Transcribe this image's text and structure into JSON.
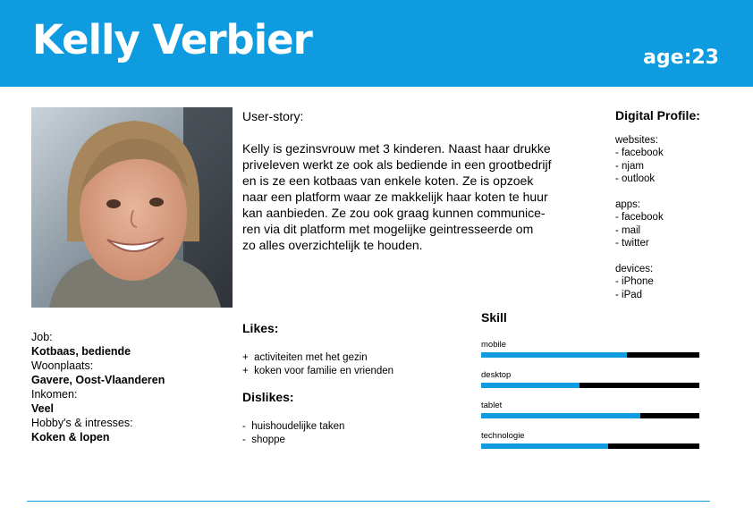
{
  "header": {
    "name": "Kelly Verbier",
    "age": "age:23"
  },
  "story": {
    "title": "User-story:",
    "lines": [
      "Kelly is gezinsvrouw met 3 kinderen. Naast haar drukke",
      "priveleven werkt ze ook als bediende in een grootbedrijf",
      "en is ze een kotbaas van enkele koten. Ze is opzoek",
      "naar een platform waar ze makkelijk haar koten te huur",
      "kan aanbieden. Ze zou ook graag kunnen communice-",
      "ren via dit platform met mogelijke geintresseerde om",
      "zo alles overzichtelijk te houden."
    ]
  },
  "digital": {
    "title": "Digital Profile:",
    "websites_label": "websites:",
    "websites": [
      "- facebook",
      "- njam",
      "- outlook"
    ],
    "apps_label": "apps:",
    "apps": [
      "- facebook",
      "- mail",
      "- twitter"
    ],
    "devices_label": "devices:",
    "devices": [
      "- iPhone",
      "- iPad"
    ]
  },
  "profile": {
    "job_label": "Job:",
    "job": "Kotbaas, bediende",
    "home_label": "Woonplaats:",
    "home": "Gavere, Oost-Vlaanderen",
    "income_label": "Inkomen:",
    "income": "Veel",
    "hobby_label": "Hobby's & intresses:",
    "hobby": "Koken & lopen"
  },
  "likes": {
    "title": "Likes:",
    "items": [
      "+  activiteiten met het gezin",
      "+  koken voor familie en vrienden"
    ]
  },
  "dislikes": {
    "title": "Dislikes:",
    "items": [
      "-  huishoudelijke taken",
      "-  shoppe"
    ]
  },
  "skills": {
    "title": "Skill",
    "items": [
      {
        "label": "mobile",
        "level": 0.67
      },
      {
        "label": "desktop",
        "level": 0.45
      },
      {
        "label": "tablet",
        "level": 0.73
      },
      {
        "label": "technologie",
        "level": 0.58
      }
    ]
  },
  "colors": {
    "accent": "#0f9bdf",
    "bar_bg": "#000000"
  }
}
